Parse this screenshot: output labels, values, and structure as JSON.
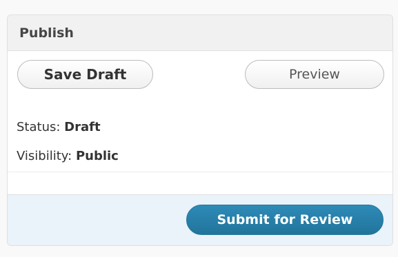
{
  "panel": {
    "title": "Publish"
  },
  "actions": {
    "save_draft_label": "Save Draft",
    "preview_label": "Preview"
  },
  "status": {
    "label": "Status:",
    "value": "Draft"
  },
  "visibility": {
    "label": "Visibility:",
    "value": "Public"
  },
  "footer": {
    "submit_label": "Submit for Review"
  },
  "colors": {
    "primary_button": "#21759b",
    "footer_bg": "#eaf2fa",
    "header_bg": "#f1f1f1"
  }
}
